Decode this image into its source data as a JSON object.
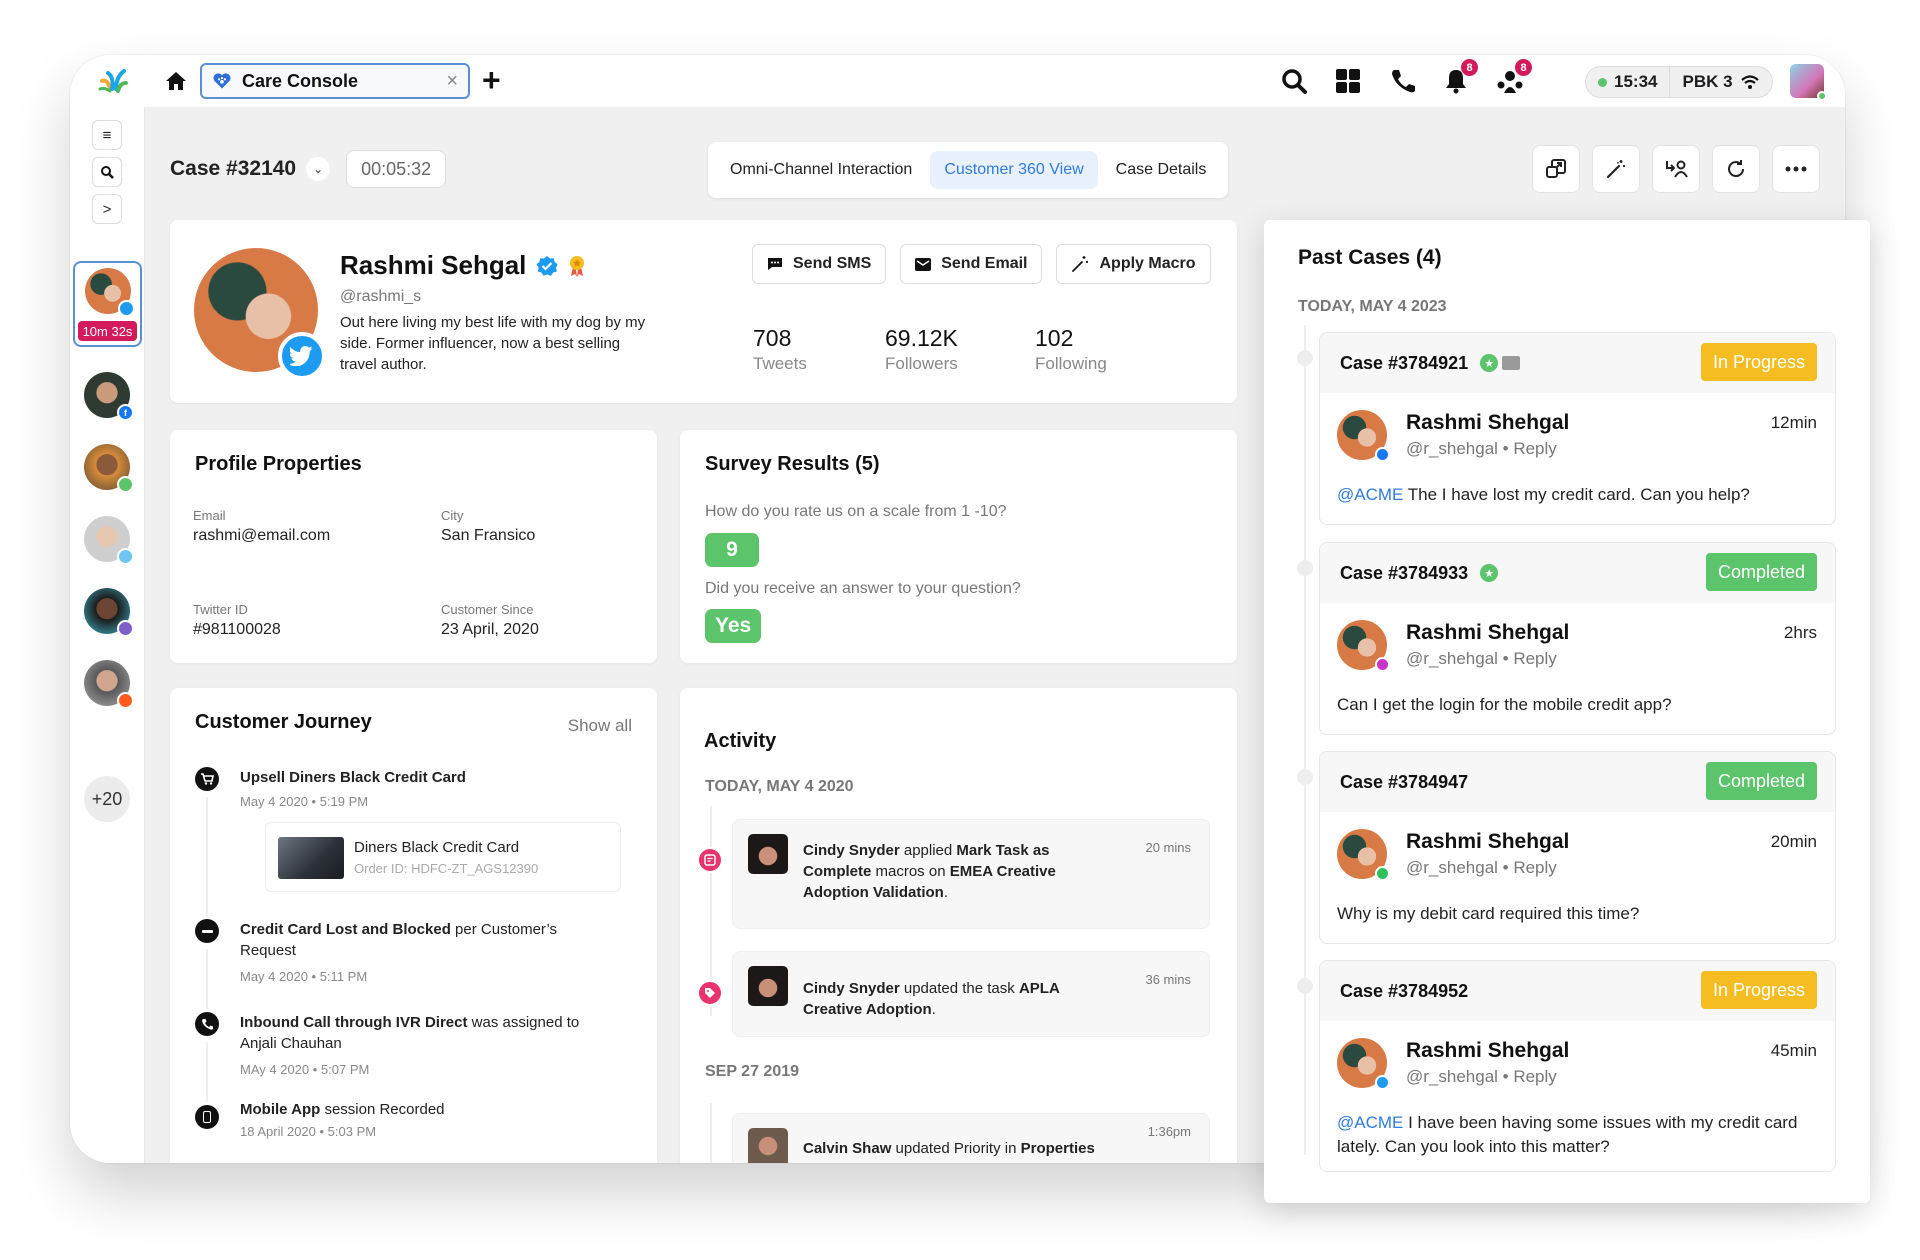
{
  "topbar": {
    "tab_label": "Care Console",
    "tab_close": "×",
    "new_tab": "+",
    "notifications_count": "8",
    "team_count": "8",
    "clock": "15:34",
    "queue": "PBK 3",
    "icons": [
      "search-icon",
      "apps-grid-icon",
      "phone-icon",
      "bell-icon",
      "team-icon",
      "wifi-icon"
    ]
  },
  "rail": {
    "menu": "≡",
    "search": "⌕",
    "expand": ">",
    "active_timer": "10m 32s",
    "conversations": [
      {
        "channel": "twitter",
        "color": "#1d9bf0"
      },
      {
        "channel": "facebook",
        "color": "#1877f2"
      },
      {
        "channel": "whatsapp",
        "color": "#5cc46a"
      },
      {
        "channel": "chat",
        "color": "#6ec6f0"
      },
      {
        "channel": "viber",
        "color": "#7d5fc9"
      },
      {
        "channel": "reddit",
        "color": "#ff5a1f"
      }
    ],
    "more_count": "+20"
  },
  "case": {
    "title": "Case #32140",
    "timer": "00:05:32",
    "tabs": [
      "Omni-Channel Interaction",
      "Customer 360 View",
      "Case Details"
    ],
    "active_tab": 1,
    "actions": [
      "popout-icon",
      "magic-wand-icon",
      "transfer-user-icon",
      "refresh-icon",
      "more-icon"
    ]
  },
  "profile": {
    "name": "Rashmi Sehgal",
    "handle": "@rashmi_s",
    "bio": "Out here living my best life with my dog by my side. Former influencer, now a best selling travel author.",
    "buttons": [
      "Send SMS",
      "Send Email",
      "Apply Macro"
    ],
    "stats": [
      {
        "value": "708",
        "label": "Tweets"
      },
      {
        "value": "69.12K",
        "label": "Followers"
      },
      {
        "value": "102",
        "label": "Following"
      }
    ]
  },
  "properties": {
    "title": "Profile Properties",
    "fields": [
      {
        "label": "Email",
        "value": "rashmi@email.com"
      },
      {
        "label": "City",
        "value": "San Fransico"
      },
      {
        "label": "Twitter ID",
        "value": "#981100028"
      },
      {
        "label": "Customer Since",
        "value": "23 April, 2020"
      }
    ]
  },
  "survey": {
    "title": "Survey Results (5)",
    "items": [
      {
        "question": "How do you rate us on a scale from 1 -10?",
        "answer": "9"
      },
      {
        "question": "Did you receive an answer to your question?",
        "answer": "Yes"
      }
    ]
  },
  "journey": {
    "title": "Customer Journey",
    "show_all": "Show all",
    "items": [
      {
        "bold": "Upsell Diners Black Credit Card",
        "rest": "",
        "date": "May 4 2020 • 5:19 PM",
        "icon": "cart-icon"
      },
      {
        "bold": "Credit Card Lost and Blocked",
        "rest": " per Customer’s Request",
        "date": "May 4 2020 • 5:11 PM",
        "icon": "block-icon"
      },
      {
        "bold": "Inbound Call through IVR Direct",
        "rest": " was assigned to Anjali Chauhan",
        "date": "MAy 4 2020 • 5:07 PM",
        "icon": "phone-icon"
      },
      {
        "bold": "Mobile App",
        "rest": " session Recorded",
        "date": "18 April 2020 • 5:03 PM",
        "icon": "mobile-icon"
      }
    ],
    "product": {
      "name": "Diners Black Credit Card",
      "order": "Order ID: HDFC-ZT_AGS12390"
    }
  },
  "activity": {
    "title": "Activity",
    "groups": [
      {
        "date": "TODAY, MAY 4 2020",
        "items": [
          {
            "parts": [
              [
                "b",
                "Cindy Snyder"
              ],
              [
                "t",
                " applied "
              ],
              [
                "b",
                "Mark Task as Complete"
              ],
              [
                "t",
                " macros on "
              ],
              [
                "b",
                "EMEA Creative Adoption Validation"
              ],
              [
                "t",
                "."
              ]
            ],
            "time": "20 mins",
            "icon": "note-icon"
          },
          {
            "parts": [
              [
                "b",
                "Cindy Snyder"
              ],
              [
                "t",
                " updated the task "
              ],
              [
                "b",
                "APLA Creative Adoption"
              ],
              [
                "t",
                "."
              ]
            ],
            "time": "36 mins",
            "icon": "tag-icon"
          }
        ]
      },
      {
        "date": "SEP 27 2019",
        "items": [
          {
            "parts": [
              [
                "b",
                "Calvin Shaw"
              ],
              [
                "t",
                " updated Priority in "
              ],
              [
                "b",
                "Properties"
              ]
            ],
            "time": "1:36pm",
            "icon": ""
          }
        ]
      }
    ]
  },
  "past_cases": {
    "title": "Past Cases (4)",
    "date": "TODAY, MAY 4 2023",
    "cases": [
      {
        "id": "Case #3784921",
        "status": "In Progress",
        "status_color": "#f5bd22",
        "star": true,
        "image": true,
        "name": "Rashmi Shehgal",
        "handle": "@r_shehgal • Reply",
        "time": "12min",
        "mention": "@ACME",
        "message": " The I have lost my credit card. Can you help?",
        "channel_color": "#1877f2"
      },
      {
        "id": "Case #3784933",
        "status": "Completed",
        "status_color": "#5cc46a",
        "star": true,
        "image": false,
        "name": "Rashmi Shehgal",
        "handle": "@r_shehgal • Reply",
        "time": "2hrs",
        "mention": "",
        "message": "Can I get the login for the mobile credit app?",
        "channel_color": "#c936c9"
      },
      {
        "id": "Case #3784947",
        "status": "Completed",
        "status_color": "#5cc46a",
        "star": false,
        "image": false,
        "name": "Rashmi Shehgal",
        "handle": "@r_shehgal • Reply",
        "time": "20min",
        "mention": "",
        "message": "Why is my debit card required this time?",
        "channel_color": "#2fc05a"
      },
      {
        "id": "Case #3784952",
        "status": "In Progress",
        "status_color": "#f5bd22",
        "star": false,
        "image": false,
        "name": "Rashmi Shehgal",
        "handle": "@r_shehgal • Reply",
        "time": "45min",
        "mention": "@ACME",
        "message": " I have been having some issues with my credit card lately. Can you look into this matter?",
        "channel_color": "#1d9bf0"
      }
    ]
  }
}
